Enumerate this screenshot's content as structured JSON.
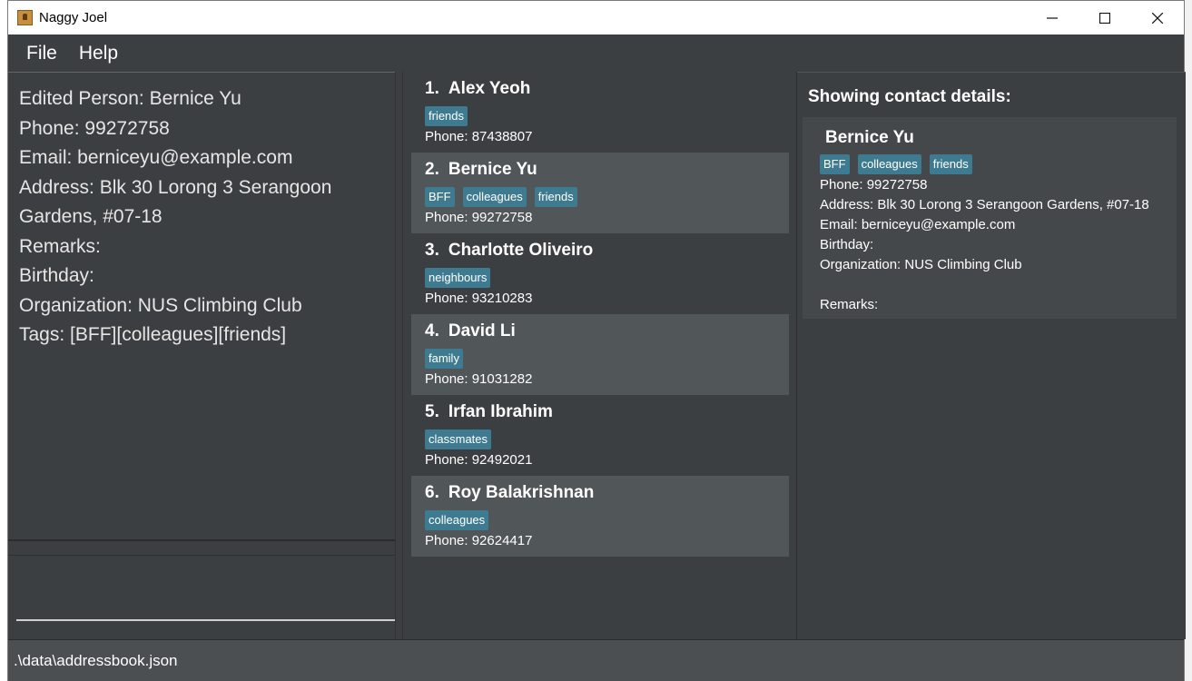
{
  "window": {
    "title": "Naggy Joel"
  },
  "menu": {
    "file": "File",
    "help": "Help"
  },
  "result_display": {
    "lines": [
      "Edited Person: Bernice Yu",
      "Phone: 99272758",
      "Email: berniceyu@example.com",
      "Address: Blk 30 Lorong 3 Serangoon",
      "Gardens, #07-18",
      "Remarks:",
      "Birthday:",
      "Organization: NUS Climbing Club",
      "Tags: [BFF][colleagues][friends]"
    ]
  },
  "command_box": {
    "value": ""
  },
  "person_list": [
    {
      "index": "1.",
      "name": "Alex Yeoh",
      "tags": [
        "friends"
      ],
      "phone": "Phone: 87438807"
    },
    {
      "index": "2.",
      "name": "Bernice Yu",
      "tags": [
        "BFF",
        "colleagues",
        "friends"
      ],
      "phone": "Phone: 99272758"
    },
    {
      "index": "3.",
      "name": "Charlotte Oliveiro",
      "tags": [
        "neighbours"
      ],
      "phone": "Phone: 93210283"
    },
    {
      "index": "4.",
      "name": "David Li",
      "tags": [
        "family"
      ],
      "phone": "Phone: 91031282"
    },
    {
      "index": "5.",
      "name": "Irfan Ibrahim",
      "tags": [
        "classmates"
      ],
      "phone": "Phone: 92492021"
    },
    {
      "index": "6.",
      "name": "Roy Balakrishnan",
      "tags": [
        "colleagues"
      ],
      "phone": "Phone: 92624417"
    }
  ],
  "details": {
    "heading": "Showing contact details:",
    "name": "Bernice Yu",
    "tags": [
      "BFF",
      "colleagues",
      "friends"
    ],
    "phone": "Phone: 99272758",
    "address": "Address: Blk 30 Lorong 3 Serangoon Gardens, #07-18",
    "email": "Email: berniceyu@example.com",
    "birthday": "Birthday:",
    "organization": "Organization: NUS Climbing Club",
    "remarks": "Remarks:"
  },
  "status_bar": {
    "path": ".\\data\\addressbook.json"
  },
  "colors": {
    "tag": "#3e7b91",
    "panel": "#3c3f41",
    "card_alt": "#515658"
  }
}
